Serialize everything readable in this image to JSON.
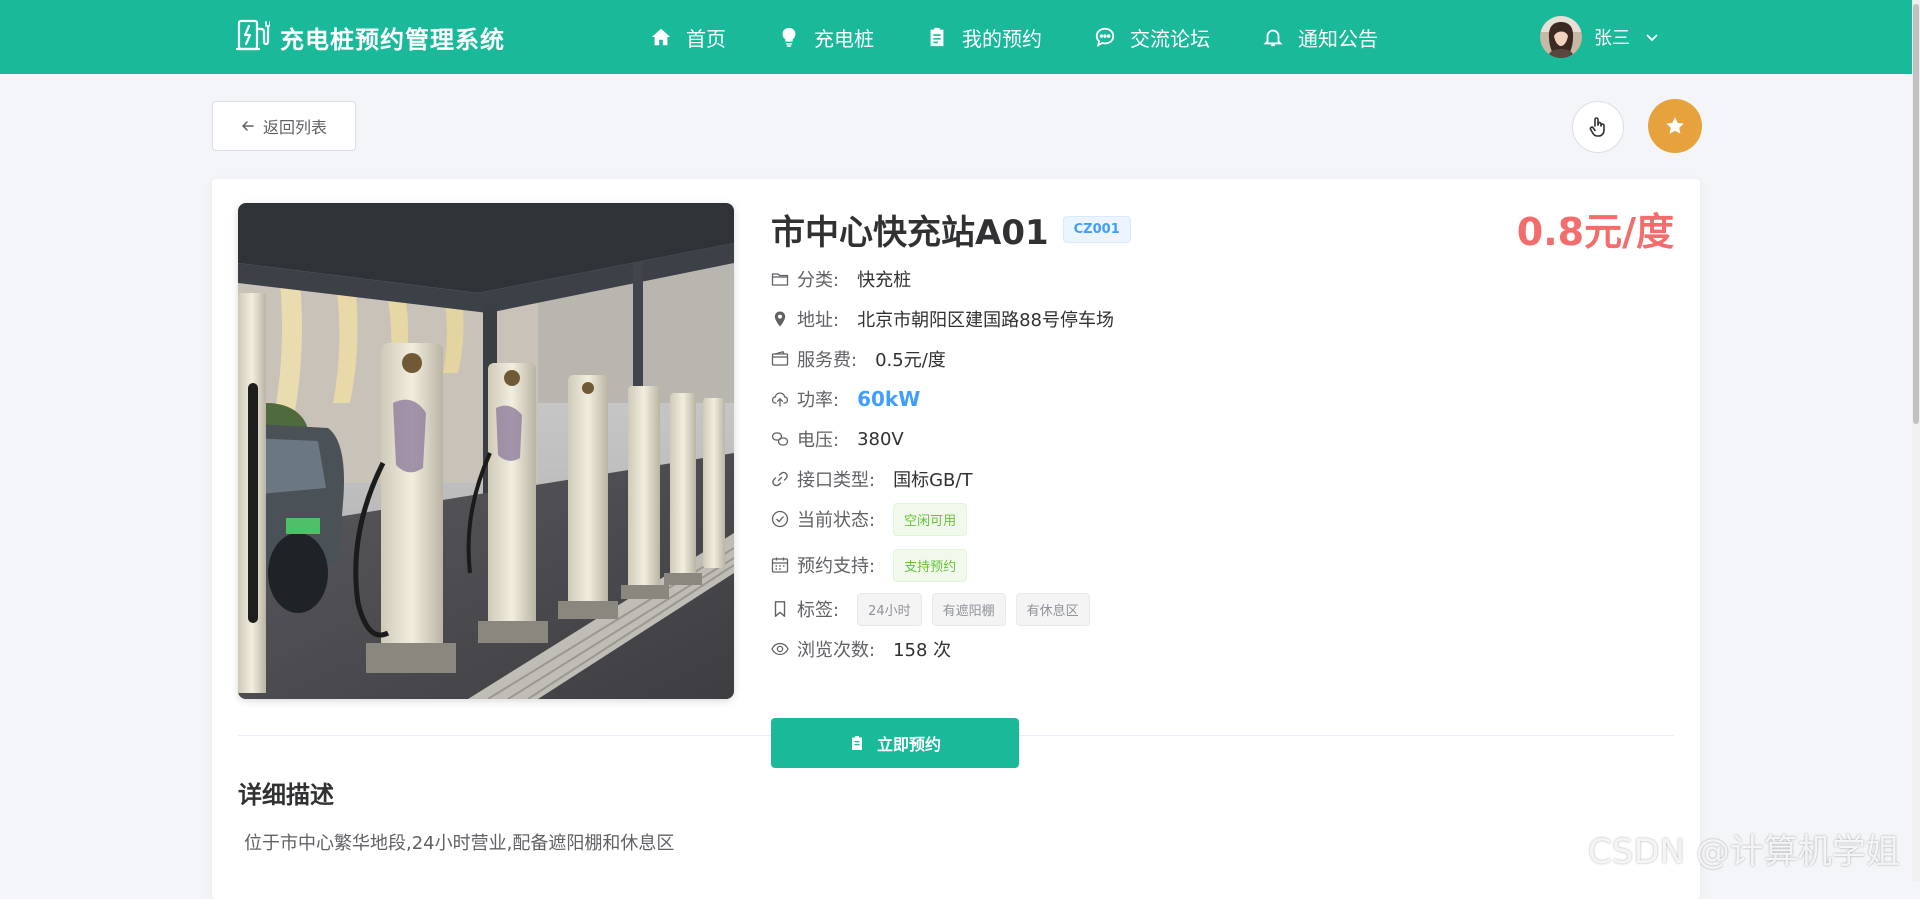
{
  "header": {
    "app_title": "充电桩预约管理系统",
    "nav": [
      {
        "label": "首页",
        "icon": "home-icon"
      },
      {
        "label": "充电桩",
        "icon": "bulb-icon"
      },
      {
        "label": "我的预约",
        "icon": "clipboard-icon"
      },
      {
        "label": "交流论坛",
        "icon": "chat-icon"
      },
      {
        "label": "通知公告",
        "icon": "bell-icon"
      }
    ],
    "user_name": "张三"
  },
  "toolbar": {
    "back_label": "返回列表"
  },
  "station": {
    "name": "市中心快充站A01",
    "code": "CZ001",
    "price": "0.8元/度",
    "fields": {
      "category_label": "分类:",
      "category_value": "快充桩",
      "address_label": "地址:",
      "address_value": "北京市朝阳区建国路88号停车场",
      "service_fee_label": "服务费:",
      "service_fee_value": "0.5元/度",
      "power_label": "功率:",
      "power_value": "60kW",
      "voltage_label": "电压:",
      "voltage_value": "380V",
      "interface_label": "接口类型:",
      "interface_value": "国标GB/T",
      "status_label": "当前状态:",
      "status_value": "空闲可用",
      "booking_label": "预约支持:",
      "booking_value": "支持预约",
      "tags_label": "标签:",
      "tags": [
        "24小时",
        "有遮阳棚",
        "有休息区"
      ],
      "views_label": "浏览次数:",
      "views_value": "158 次"
    },
    "reserve_label": "立即预约",
    "detail_title": "详细描述",
    "description": "位于市中心繁华地段,24小时营业,配备遮阳棚和休息区"
  },
  "watermark": "CSDN @计算机学姐",
  "colors": {
    "primary": "#19b99a",
    "price": "#f56c6c",
    "link": "#409eff",
    "favorite": "#e6a23c",
    "success": "#67c23a"
  }
}
